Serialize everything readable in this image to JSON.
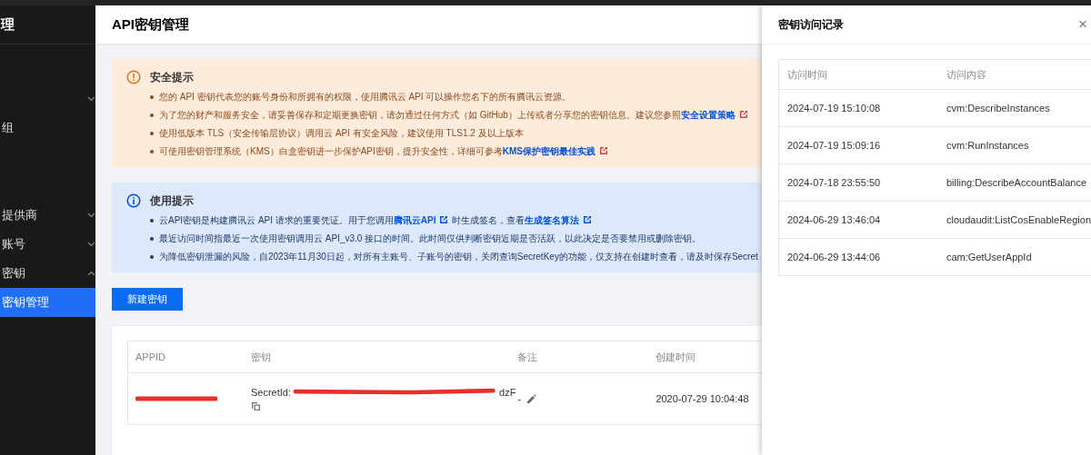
{
  "sidebar": {
    "title": "理",
    "items": [
      {
        "expanded": false
      },
      {
        "label": "组"
      },
      {
        "label": "提供商",
        "expanded": false
      },
      {
        "label": "账号",
        "expanded": false
      },
      {
        "label": "密钥",
        "expanded": true
      },
      {
        "label": "密钥管理",
        "selected": true
      }
    ]
  },
  "page": {
    "title": "API密钥管理"
  },
  "notices": [
    {
      "kind": "warning",
      "title": "安全提示",
      "lines": [
        [
          {
            "text": "您的 API 密钥代表您的账号身份和所拥有的权限，使用腾讯云 API 可以操作您名下的所有腾讯云资源。"
          }
        ],
        [
          {
            "text": "为了您的财产和服务安全，请妥善保存和定期更换密钥，请勿通过任何方式（如 GitHub）上传或者分享您的密钥信息。建议您参照"
          },
          {
            "text": "安全设置策略",
            "kind": "link"
          }
        ],
        [
          {
            "text": "使用低版本 TLS（安全传输层协议）调用云 API 有安全风险，建议使用 TLS1.2 及以上版本"
          }
        ],
        [
          {
            "text": "可使用密钥管理系统（KMS）白盒密钥进一步保护API密钥，提升安全性，详细可参考"
          },
          {
            "text": "KMS保护密钥最佳实践",
            "kind": "link"
          }
        ]
      ]
    },
    {
      "kind": "info",
      "title": "使用提示",
      "lines": [
        [
          {
            "text": "云API密钥是构建腾讯云 API 请求的重要凭证。用于您调用"
          },
          {
            "text": "腾讯云API",
            "kind": "link"
          },
          {
            "text": "时生成签名，查看"
          },
          {
            "text": "生成签名算法",
            "kind": "link"
          }
        ],
        [
          {
            "text": "最近访问时间指最近一次使用密钥调用云 API_v3.0 接口的时间。此时间仅供判断密钥近期是否活跃，以此决定是否要禁用或删除密钥。"
          }
        ],
        [
          {
            "text": "为降低密钥泄漏的风险，自2023年11月30日起，对所有主账号、子账号的密钥，关闭查询SecretKey的功能，仅支持在创建时查看，请及时保存Secret"
          }
        ]
      ]
    }
  ],
  "create_button": "新建密钥",
  "keys_table": {
    "columns": [
      "APPID",
      "密钥",
      "备注",
      "创建时间"
    ],
    "rows": [
      {
        "secret_label": "SecretId:",
        "secret_tail": "dzF",
        "remark": "-",
        "created": "2020-07-29 10:04:48"
      }
    ]
  },
  "drawer": {
    "title": "密钥访问记录",
    "close": "×",
    "columns": [
      "访问时间",
      "访问内容"
    ],
    "rows": [
      {
        "time": "2024-07-19 15:10:08",
        "content": "cvm:DescribeInstances"
      },
      {
        "time": "2024-07-19 15:09:16",
        "content": "cvm:RunInstances"
      },
      {
        "time": "2024-07-18 23:55:50",
        "content": "billing:DescribeAccountBalance"
      },
      {
        "time": "2024-06-29 13:46:04",
        "content": "cloudaudit:ListCosEnableRegion"
      },
      {
        "time": "2024-06-29 13:44:06",
        "content": "cam:GetUserAppId"
      }
    ]
  }
}
